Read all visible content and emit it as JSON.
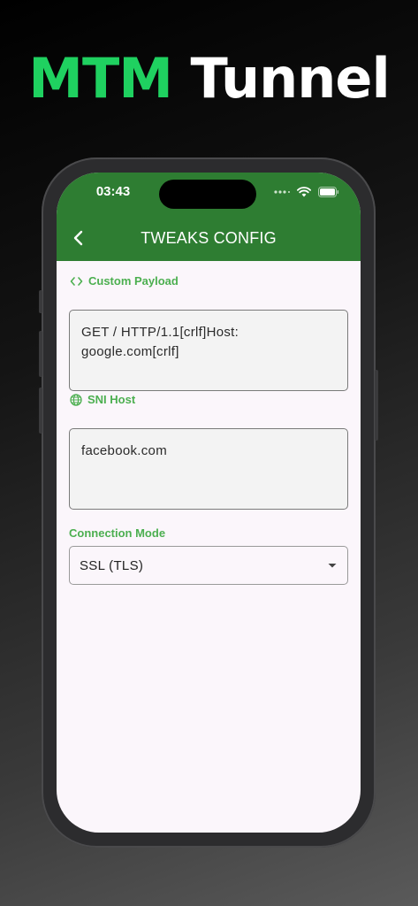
{
  "headline": {
    "part1": "MTM",
    "part2": "Tunnel"
  },
  "status_bar": {
    "time": "03:43",
    "icons": [
      "signal-dots-icon",
      "wifi-icon",
      "battery-icon"
    ]
  },
  "app_bar": {
    "title": "TWEAKS CONFIG",
    "back_icon": "chevron-left-icon"
  },
  "custom_payload": {
    "label": "Custom Payload",
    "icon": "code-icon",
    "value": "GET / HTTP/1.1[crlf]Host: google.com[crlf]"
  },
  "sni_host": {
    "label": "SNI Host",
    "icon": "globe-icon",
    "value": "facebook.com"
  },
  "connection_mode": {
    "label": "Connection Mode",
    "selected": "SSL (TLS)",
    "icon": "dropdown-arrow-icon"
  },
  "colors": {
    "brand_green": "#1fd160",
    "app_bar": "#2e7d32",
    "label_green": "#4caf50",
    "screen_bg": "#fbf6fb"
  }
}
